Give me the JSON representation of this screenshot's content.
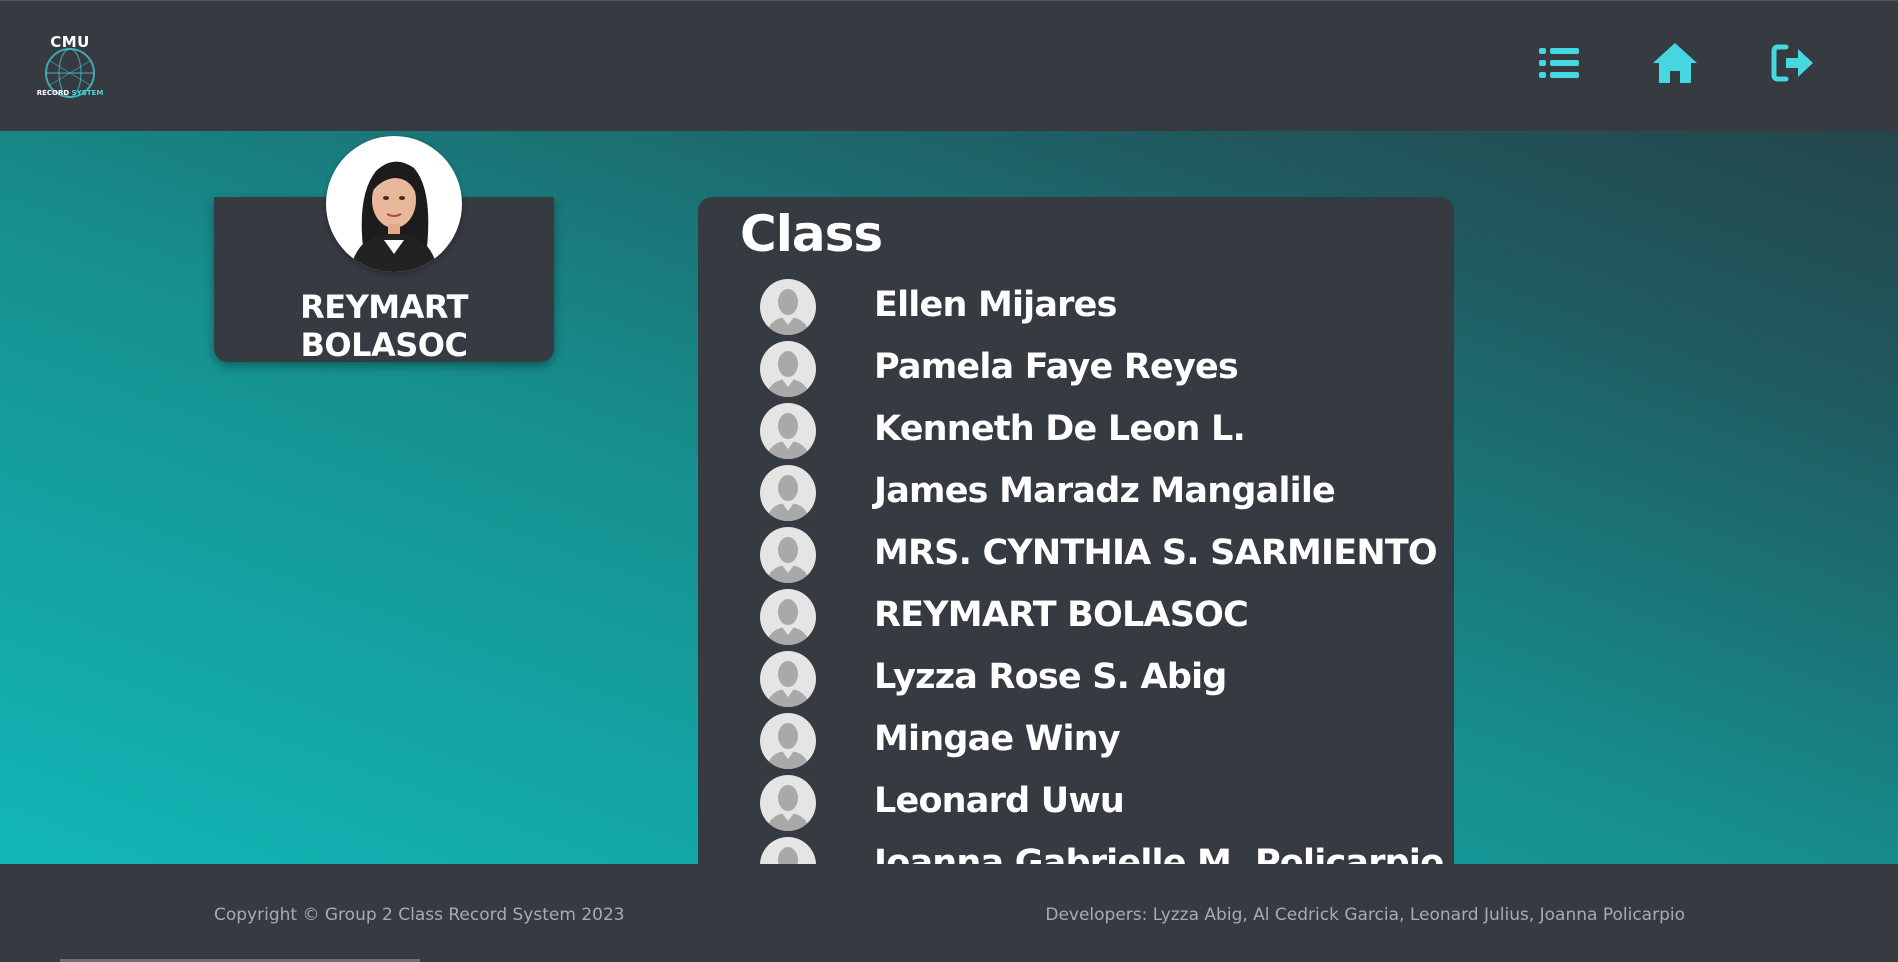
{
  "brand": {
    "logo_title": "CMU",
    "logo_sub_1": "RECORD",
    "logo_sub_2": "SYSTEM",
    "accent_color": "#47d7e0"
  },
  "nav": {
    "icons": [
      "list-icon",
      "home-icon",
      "logout-icon"
    ]
  },
  "profile": {
    "name": "REYMART BOLASOC"
  },
  "class_panel": {
    "title": "Class",
    "students": [
      {
        "name": "Ellen Mijares"
      },
      {
        "name": "Pamela Faye Reyes"
      },
      {
        "name": "Kenneth De Leon L."
      },
      {
        "name": "James Maradz Mangalile"
      },
      {
        "name": "MRS. CYNTHIA S. SARMIENTO"
      },
      {
        "name": "REYMART BOLASOC"
      },
      {
        "name": "Lyzza Rose S. Abig"
      },
      {
        "name": "Mingae Winy"
      },
      {
        "name": "Leonard Uwu"
      },
      {
        "name": "Joanna Gabrielle M. Policarpio"
      }
    ]
  },
  "footer": {
    "copyright": "Copyright © Group 2 Class Record System 2023",
    "developers": "Developers: Lyzza Abig, Al Cedrick Garcia, Leonard Julius, Joanna Policarpio"
  }
}
